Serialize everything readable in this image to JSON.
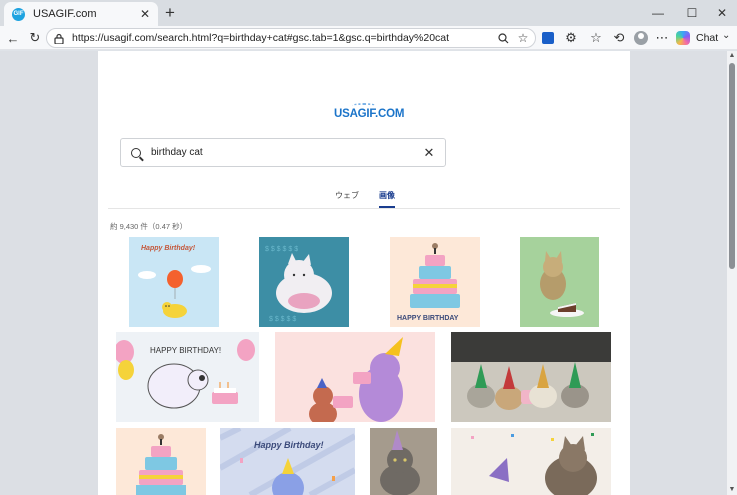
{
  "browser": {
    "tab_title": "USAGIF.com",
    "favicon_text": "GIF",
    "url": "https://usagif.com/search.html?q=birthday+cat#gsc.tab=1&gsc.q=birthday%20cat",
    "copilot_label": "Chat"
  },
  "site": {
    "logo": "USAGIF.COM",
    "search_value": "birthday cat",
    "tabs": {
      "web": "ウェブ",
      "images": "画像"
    },
    "result_count": "約 9,430 件（0.47 秒）"
  },
  "images": {
    "captions": {
      "img1": "Happy Birthday!",
      "img3": "HAPPY BIRTHDAY",
      "img5": "HAPPY BIRTHDAY!",
      "img10": "Happy Birthday!"
    }
  }
}
